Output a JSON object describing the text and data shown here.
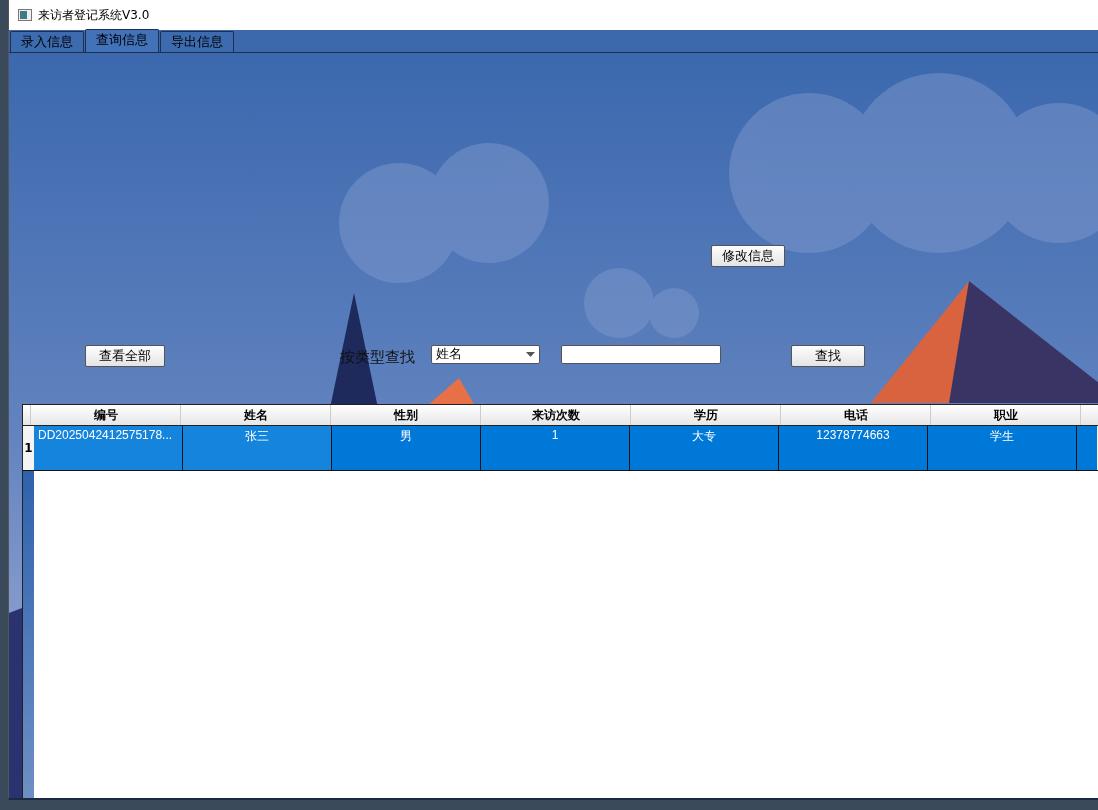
{
  "window": {
    "title": "来访者登记系统V3.0"
  },
  "tabs": [
    {
      "label": "录入信息",
      "selected": false
    },
    {
      "label": "查询信息",
      "selected": true
    },
    {
      "label": "导出信息",
      "selected": false
    }
  ],
  "buttons": {
    "edit": "修改信息",
    "view_all": "查看全部",
    "search": "查找"
  },
  "search": {
    "label": "按类型查找",
    "type_select": "姓名"
  },
  "table": {
    "columns": [
      "编号",
      "姓名",
      "性别",
      "来访次数",
      "学历",
      "电话",
      "职业"
    ],
    "rows": [
      {
        "header": "1",
        "selected": true,
        "cells": [
          "DD2025042412575178...",
          "张三",
          "男",
          "1",
          "大专",
          "12378774663",
          "学生"
        ]
      }
    ]
  }
}
